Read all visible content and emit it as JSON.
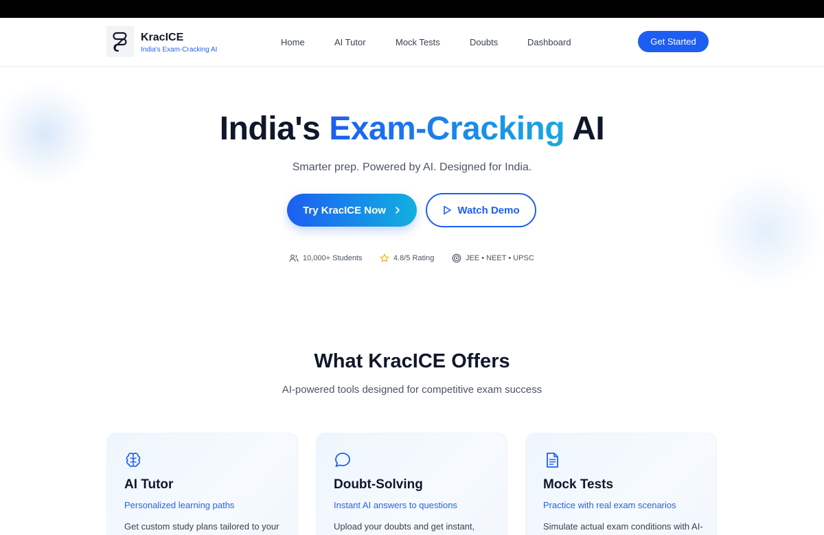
{
  "brand": {
    "name": "KracICE",
    "tagline": "India's Exam-Cracking AI",
    "logo_icon": "knot-logo-icon"
  },
  "nav": {
    "items": [
      {
        "label": "Home"
      },
      {
        "label": "AI Tutor"
      },
      {
        "label": "Mock Tests"
      },
      {
        "label": "Doubts"
      },
      {
        "label": "Dashboard"
      }
    ],
    "cta_label": "Get Started"
  },
  "hero": {
    "title_start": "India's ",
    "title_highlight": "Exam-Cracking",
    "title_end": " AI",
    "subtitle": "Smarter prep. Powered by AI. Designed for India.",
    "primary_button": "Try KracICE Now",
    "secondary_button": "Watch Demo",
    "stats": [
      {
        "icon": "users-icon",
        "label": "10,000+ Students"
      },
      {
        "icon": "star-icon",
        "label": "4.8/5 Rating"
      },
      {
        "icon": "target-icon",
        "label": "JEE • NEET • UPSC"
      }
    ]
  },
  "offers": {
    "title": "What KracICE Offers",
    "subtitle": "AI-powered tools designed for competitive exam success",
    "cards": [
      {
        "icon": "brain-icon",
        "title": "AI Tutor",
        "subtitle": "Personalized learning paths",
        "description": "Get custom study plans tailored to your strengths and weaknesses"
      },
      {
        "icon": "chat-bubble-icon",
        "title": "Doubt-Solving",
        "subtitle": "Instant AI answers to questions",
        "description": "Upload your doubts and get instant, detailed explanations"
      },
      {
        "icon": "document-icon",
        "title": "Mock Tests",
        "subtitle": "Practice with real exam scenarios",
        "description": "Simulate actual exam conditions with AI-powered test reviews"
      }
    ]
  },
  "colors": {
    "primary": "#1d5ef2",
    "accent": "#12b0e0",
    "heading": "#0f172a",
    "body_text": "#4b5563",
    "star": "#eab308"
  }
}
